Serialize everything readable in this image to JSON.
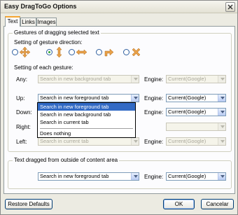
{
  "window": {
    "title": "Easy DragToGo Options"
  },
  "tabs": [
    "Text",
    "Links",
    "Images"
  ],
  "gestures": {
    "group_title": "Gestures of dragging selected text",
    "direction_label": "Setting of gesture direction:",
    "direction_options": [
      {
        "icon": "four-way-arrows-icon",
        "checked": false
      },
      {
        "icon": "up-down-arrows-icon",
        "checked": true
      },
      {
        "icon": "left-right-arrows-icon",
        "checked": false
      },
      {
        "icon": "diagonal-arrow-icon",
        "checked": false
      },
      {
        "icon": "cross-icon",
        "checked": false
      }
    ],
    "each_label": "Setting of each gesture:",
    "rows": [
      {
        "label": "Any:",
        "action": "Search in new background tab",
        "engine_label": "Engine:",
        "engine": "Current(Google)",
        "disabled": true
      },
      {
        "label": "Up:",
        "action": "Search in new foreground tab",
        "engine_label": "Engine:",
        "engine": "Current(Google)",
        "disabled": false
      },
      {
        "label": "Down:",
        "action": "",
        "engine_label": "Engine:",
        "engine": "Current(Google)",
        "disabled": false
      },
      {
        "label": "Right:",
        "action": "",
        "engine_label": "",
        "engine": "",
        "disabled": true
      },
      {
        "label": "Left:",
        "action": "Search in current tab",
        "engine_label": "Engine:",
        "engine": "Current(Google)",
        "disabled": true
      }
    ]
  },
  "dropdown": {
    "items": [
      "Search in new foreground tab",
      "Search in new background tab",
      "Search in current tab",
      "Does nothing"
    ],
    "selected_index": 0
  },
  "outside": {
    "group_title": "Text dragged from outside of content area",
    "action": "Search in new foreground tab",
    "engine_label": "Engine:",
    "engine": "Current(Google)"
  },
  "buttons": {
    "restore": "Restore Defaults",
    "ok": "OK",
    "cancel": "Cancelar"
  }
}
